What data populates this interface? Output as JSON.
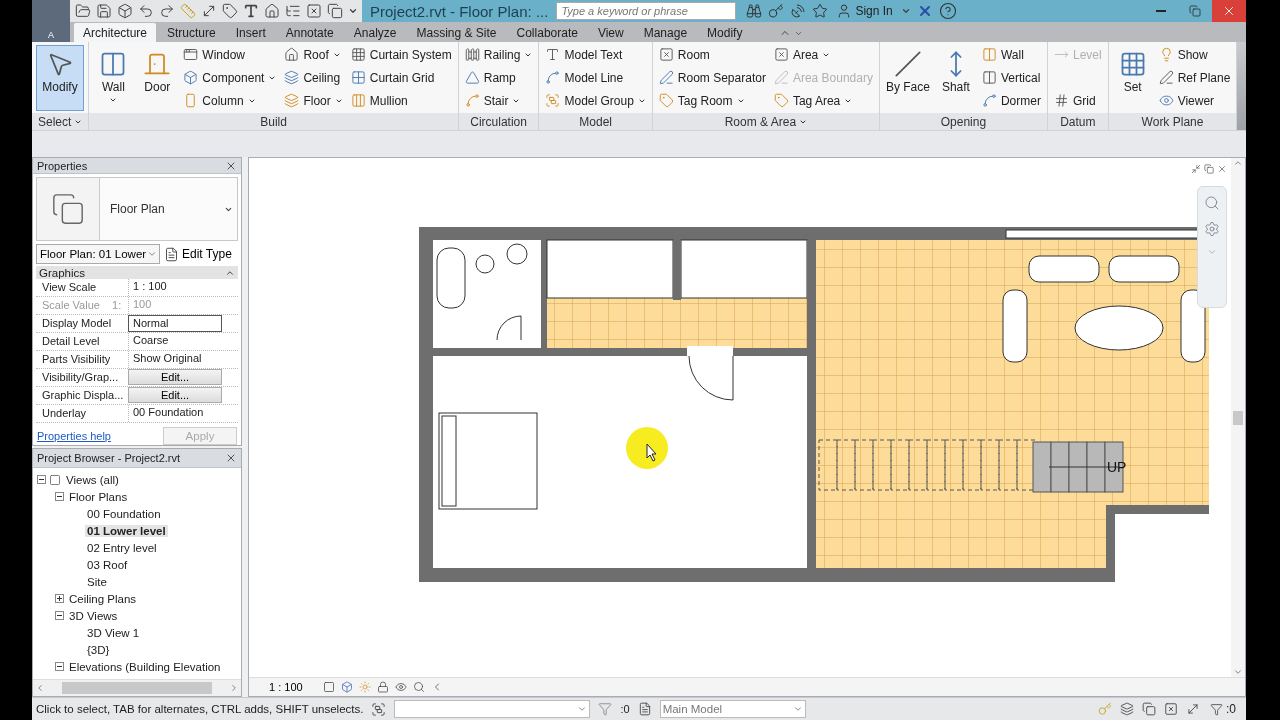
{
  "title_bar": {
    "app_label": "A",
    "title": "Project2.rvt - Floor Plan: ...",
    "search_placeholder": "Type a keyword or phrase",
    "sign_in": "Sign In"
  },
  "ribbon": {
    "tabs": [
      {
        "label": "Architecture",
        "selected": true
      },
      {
        "label": "Structure",
        "selected": false
      },
      {
        "label": "Insert",
        "selected": false
      },
      {
        "label": "Annotate",
        "selected": false
      },
      {
        "label": "Analyze",
        "selected": false
      },
      {
        "label": "Massing & Site",
        "selected": false
      },
      {
        "label": "Collaborate",
        "selected": false
      },
      {
        "label": "View",
        "selected": false
      },
      {
        "label": "Manage",
        "selected": false
      },
      {
        "label": "Modify",
        "selected": false
      }
    ],
    "panels": [
      {
        "title": "Select",
        "dropdown": true,
        "columns": [
          [
            {
              "label": "Modify",
              "kind": "large",
              "dropdown": false,
              "disabled": false,
              "selected": true
            }
          ]
        ]
      },
      {
        "title": "Build",
        "dropdown": false,
        "columns": [
          [
            {
              "label": "Wall",
              "kind": "large",
              "dropdown": true,
              "disabled": false,
              "selected": false
            }
          ],
          [
            {
              "label": "Door",
              "kind": "large",
              "dropdown": false,
              "disabled": false,
              "selected": false
            }
          ],
          [
            {
              "label": "Window",
              "kind": "small",
              "dropdown": false,
              "disabled": false,
              "selected": false
            },
            {
              "label": "Component",
              "kind": "small",
              "dropdown": true,
              "disabled": false,
              "selected": false
            },
            {
              "label": "Column",
              "kind": "small",
              "dropdown": true,
              "disabled": false,
              "selected": false
            }
          ],
          [
            {
              "label": "Roof",
              "kind": "small",
              "dropdown": true,
              "disabled": false,
              "selected": false
            },
            {
              "label": "Ceiling",
              "kind": "small",
              "dropdown": false,
              "disabled": false,
              "selected": false
            },
            {
              "label": "Floor",
              "kind": "small",
              "dropdown": true,
              "disabled": false,
              "selected": false
            }
          ],
          [
            {
              "label": "Curtain System",
              "kind": "small",
              "dropdown": false,
              "disabled": false,
              "selected": false
            },
            {
              "label": "Curtain Grid",
              "kind": "small",
              "dropdown": false,
              "disabled": false,
              "selected": false
            },
            {
              "label": "Mullion",
              "kind": "small",
              "dropdown": false,
              "disabled": false,
              "selected": false
            }
          ]
        ]
      },
      {
        "title": "Circulation",
        "dropdown": false,
        "columns": [
          [
            {
              "label": "Railing",
              "kind": "small",
              "dropdown": true,
              "disabled": false,
              "selected": false
            },
            {
              "label": "Ramp",
              "kind": "small",
              "dropdown": false,
              "disabled": false,
              "selected": false
            },
            {
              "label": "Stair",
              "kind": "small",
              "dropdown": true,
              "disabled": false,
              "selected": false
            }
          ]
        ]
      },
      {
        "title": "Model",
        "dropdown": false,
        "columns": [
          [
            {
              "label": "Model Text",
              "kind": "small",
              "dropdown": false,
              "disabled": false,
              "selected": false
            },
            {
              "label": "Model Line",
              "kind": "small",
              "dropdown": false,
              "disabled": false,
              "selected": false
            },
            {
              "label": "Model Group",
              "kind": "small",
              "dropdown": true,
              "disabled": false,
              "selected": false
            }
          ]
        ]
      },
      {
        "title": "Room & Area",
        "dropdown": true,
        "columns": [
          [
            {
              "label": "Room",
              "kind": "small",
              "dropdown": false,
              "disabled": false,
              "selected": false
            },
            {
              "label": "Room Separator",
              "kind": "small",
              "dropdown": false,
              "disabled": false,
              "selected": false
            },
            {
              "label": "Tag Room",
              "kind": "small",
              "dropdown": true,
              "disabled": false,
              "selected": false
            }
          ],
          [
            {
              "label": "Area",
              "kind": "small",
              "dropdown": true,
              "disabled": false,
              "selected": false
            },
            {
              "label": "Area Boundary",
              "kind": "small",
              "dropdown": false,
              "disabled": true,
              "selected": false
            },
            {
              "label": "Tag Area",
              "kind": "small",
              "dropdown": true,
              "disabled": false,
              "selected": false
            }
          ]
        ]
      },
      {
        "title": "Opening",
        "dropdown": false,
        "columns": [
          [
            {
              "label": "By Face",
              "kind": "large",
              "dropdown": false,
              "disabled": false,
              "selected": false
            }
          ],
          [
            {
              "label": "Shaft",
              "kind": "large",
              "dropdown": false,
              "disabled": false,
              "selected": false
            }
          ],
          [
            {
              "label": "Wall",
              "kind": "small",
              "dropdown": false,
              "disabled": false,
              "selected": false
            },
            {
              "label": "Vertical",
              "kind": "small",
              "dropdown": false,
              "disabled": false,
              "selected": false
            },
            {
              "label": "Dormer",
              "kind": "small",
              "dropdown": false,
              "disabled": false,
              "selected": false
            }
          ]
        ]
      },
      {
        "title": "Datum",
        "dropdown": false,
        "columns": [
          [
            {
              "label": "Level",
              "kind": "small",
              "dropdown": false,
              "disabled": true,
              "selected": false
            },
            {
              "label": "Grid",
              "kind": "small",
              "dropdown": false,
              "disabled": false,
              "selected": false
            }
          ]
        ]
      },
      {
        "title": "Work Plane",
        "dropdown": false,
        "columns": [
          [
            {
              "label": "Set",
              "kind": "large",
              "dropdown": false,
              "disabled": false,
              "selected": false
            }
          ],
          [
            {
              "label": "Show",
              "kind": "small",
              "dropdown": false,
              "disabled": false,
              "selected": false
            },
            {
              "label": "Ref Plane",
              "kind": "small",
              "dropdown": false,
              "disabled": false,
              "selected": false
            },
            {
              "label": "Viewer",
              "kind": "small",
              "dropdown": false,
              "disabled": false,
              "selected": false
            }
          ]
        ]
      }
    ]
  },
  "properties": {
    "title": "Properties",
    "type_name": "Floor Plan",
    "view_selector": "Floor Plan: 01 Lower",
    "edit_type": "Edit Type",
    "group": "Graphics",
    "group_expanded": true,
    "rows": [
      {
        "name": "View Scale",
        "value": "1 : 100",
        "kind": "text",
        "disabled": false
      },
      {
        "name": "Scale Value    1:",
        "value": "100",
        "kind": "text",
        "disabled": true
      },
      {
        "name": "Display Model",
        "value": "Normal",
        "kind": "field",
        "disabled": false
      },
      {
        "name": "Detail Level",
        "value": "Coarse",
        "kind": "text",
        "disabled": false
      },
      {
        "name": "Parts Visibility",
        "value": "Show Original",
        "kind": "text",
        "disabled": false
      },
      {
        "name": "Visibility/Grap...",
        "value": "Edit...",
        "kind": "button",
        "disabled": false
      },
      {
        "name": "Graphic Displa...",
        "value": "Edit...",
        "kind": "button",
        "disabled": false
      },
      {
        "name": "Underlay",
        "value": "00 Foundation",
        "kind": "text",
        "disabled": false
      }
    ],
    "help_link": "Properties help",
    "apply": "Apply",
    "apply_disabled": true
  },
  "project_browser": {
    "title": "Project Browser - Project2.rvt",
    "tree": [
      {
        "label": "Views (all)",
        "expanded": true,
        "selected": false,
        "children": [
          {
            "label": "Floor Plans",
            "expanded": true,
            "selected": false,
            "children": [
              {
                "label": "00 Foundation",
                "selected": false
              },
              {
                "label": "01 Lower level",
                "selected": true
              },
              {
                "label": "02 Entry level",
                "selected": false
              },
              {
                "label": "03 Roof",
                "selected": false
              },
              {
                "label": "Site",
                "selected": false
              }
            ]
          },
          {
            "label": "Ceiling Plans",
            "expanded": false,
            "selected": false
          },
          {
            "label": "3D Views",
            "expanded": true,
            "selected": false,
            "children": [
              {
                "label": "3D View 1",
                "selected": false
              },
              {
                "label": "{3D}",
                "selected": false
              }
            ]
          },
          {
            "label": "Elevations (Building Elevation",
            "expanded": true,
            "selected": false
          }
        ]
      }
    ]
  },
  "view_bar": {
    "scale": "1 : 100"
  },
  "plan": {
    "stair_label": "UP"
  },
  "status_bar": {
    "hint": "Click to select, TAB for alternates, CTRL adds, SHIFT unselects.",
    "pick_count": ":0",
    "workset": "Main Model",
    "filter_count": ":0"
  }
}
